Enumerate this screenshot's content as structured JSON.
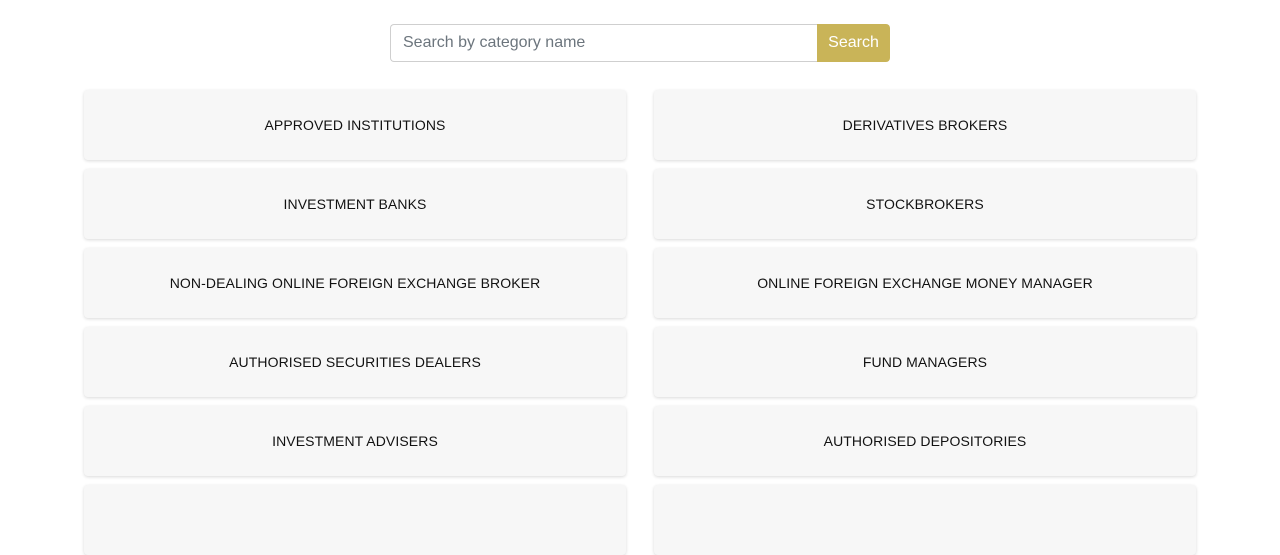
{
  "search": {
    "placeholder": "Search by category name",
    "value": "",
    "button_label": "Search"
  },
  "colors": {
    "accent": "#c9b458"
  },
  "categories": [
    {
      "label": "APPROVED INSTITUTIONS"
    },
    {
      "label": "DERIVATIVES BROKERS"
    },
    {
      "label": "INVESTMENT BANKS"
    },
    {
      "label": "STOCKBROKERS"
    },
    {
      "label": "NON-DEALING ONLINE FOREIGN EXCHANGE BROKER"
    },
    {
      "label": "ONLINE FOREIGN EXCHANGE MONEY MANAGER"
    },
    {
      "label": "AUTHORISED SECURITIES DEALERS"
    },
    {
      "label": "FUND MANAGERS"
    },
    {
      "label": "INVESTMENT ADVISERS"
    },
    {
      "label": "AUTHORISED DEPOSITORIES"
    },
    {
      "label": ""
    },
    {
      "label": ""
    }
  ]
}
